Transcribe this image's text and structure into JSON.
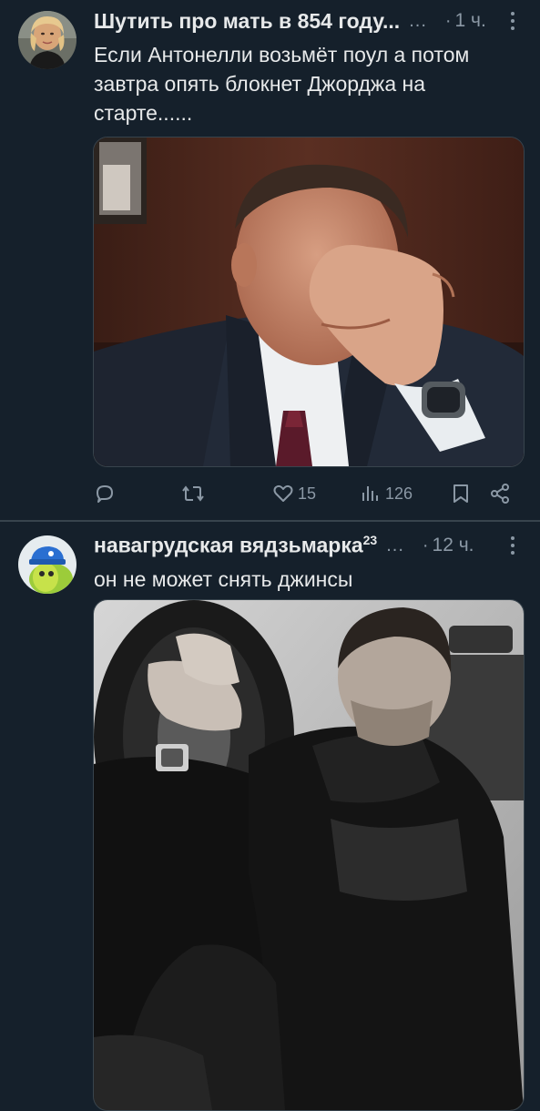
{
  "tweets": [
    {
      "author": "Шутить про мать в 854 году...",
      "truncation": "...",
      "dot": "·",
      "time": "1 ч.",
      "text": "Если Антонелли возьмёт поул а потом завтра опять блокнет Джорджа на старте......",
      "media_subject": "man-facepalm-photo",
      "actions": {
        "likes": "15",
        "views": "126"
      }
    },
    {
      "author": "навагрудская вядзьмарка",
      "author_sup": "23",
      "truncation": "...",
      "dot": "·",
      "time": "12 ч.",
      "text": "он не может снять джинсы",
      "media_subject": "man-leaning-on-race-car-photo"
    }
  ],
  "icons": [
    "reply-icon",
    "retweet-icon",
    "like-icon",
    "views-icon",
    "bookmark-icon",
    "share-icon",
    "more-icon"
  ],
  "colors": {
    "background": "#15202b",
    "text": "#e7e9ea",
    "secondary": "#8b98a5",
    "divider": "#38444d"
  }
}
